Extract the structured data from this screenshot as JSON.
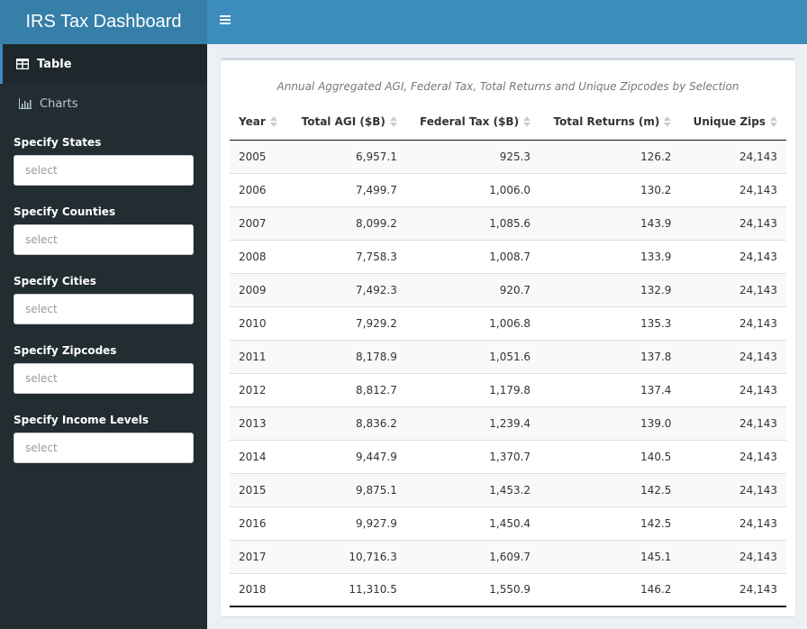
{
  "header": {
    "title": "IRS Tax Dashboard",
    "menu_icon": "hamburger-icon"
  },
  "sidebar": {
    "menu": [
      {
        "label": "Table",
        "icon": "table-icon",
        "active": true
      },
      {
        "label": "Charts",
        "icon": "bar-chart-icon",
        "active": false
      }
    ],
    "filters": [
      {
        "label": "Specify States",
        "placeholder": "select"
      },
      {
        "label": "Specify Counties",
        "placeholder": "select"
      },
      {
        "label": "Specify Cities",
        "placeholder": "select"
      },
      {
        "label": "Specify Zipcodes",
        "placeholder": "select"
      },
      {
        "label": "Specify Income Levels",
        "placeholder": "select"
      }
    ]
  },
  "table": {
    "caption": "Annual Aggregated AGI, Federal Tax, Total Returns and Unique Zipcodes by Selection",
    "columns": [
      "Year",
      "Total AGI ($B)",
      "Federal Tax ($B)",
      "Total Returns (m)",
      "Unique Zips"
    ],
    "rows": [
      [
        "2005",
        "6,957.1",
        "925.3",
        "126.2",
        "24,143"
      ],
      [
        "2006",
        "7,499.7",
        "1,006.0",
        "130.2",
        "24,143"
      ],
      [
        "2007",
        "8,099.2",
        "1,085.6",
        "143.9",
        "24,143"
      ],
      [
        "2008",
        "7,758.3",
        "1,008.7",
        "133.9",
        "24,143"
      ],
      [
        "2009",
        "7,492.3",
        "920.7",
        "132.9",
        "24,143"
      ],
      [
        "2010",
        "7,929.2",
        "1,006.8",
        "135.3",
        "24,143"
      ],
      [
        "2011",
        "8,178.9",
        "1,051.6",
        "137.8",
        "24,143"
      ],
      [
        "2012",
        "8,812.7",
        "1,179.8",
        "137.4",
        "24,143"
      ],
      [
        "2013",
        "8,836.2",
        "1,239.4",
        "139.0",
        "24,143"
      ],
      [
        "2014",
        "9,447.9",
        "1,370.7",
        "140.5",
        "24,143"
      ],
      [
        "2015",
        "9,875.1",
        "1,453.2",
        "142.5",
        "24,143"
      ],
      [
        "2016",
        "9,927.9",
        "1,450.4",
        "142.5",
        "24,143"
      ],
      [
        "2017",
        "10,716.3",
        "1,609.7",
        "145.1",
        "24,143"
      ],
      [
        "2018",
        "11,310.5",
        "1,550.9",
        "146.2",
        "24,143"
      ]
    ]
  }
}
